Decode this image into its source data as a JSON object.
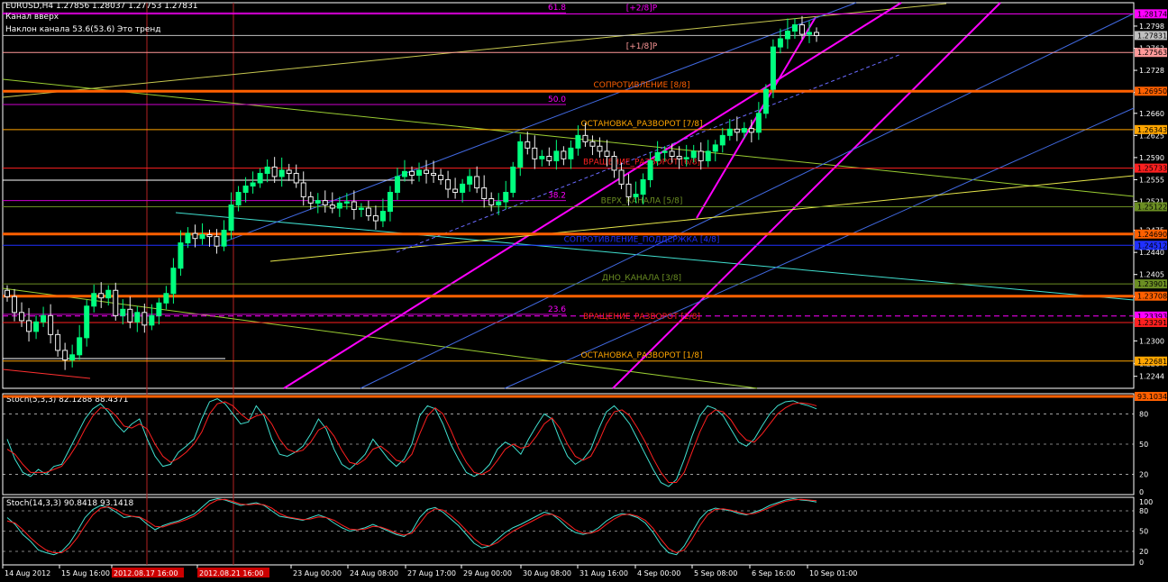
{
  "header": {
    "symbol_line": "EURUSD,H4  1.27856 1.28037 1.27753 1.27831",
    "channel_line": "Канал  вверх",
    "slope_label": "Наклон канала 53.6(53.6)",
    "trend_label": "Это тренд"
  },
  "chart_data": {
    "type": "candlestick",
    "symbol": "EURUSD",
    "timeframe": "H4",
    "ohlc": {
      "open": 1.27856,
      "high": 1.28037,
      "low": 1.27753,
      "close": 1.27831
    },
    "ylim": [
      1.2225,
      1.2835
    ],
    "price_ticks": [
      1.2798,
      1.2763,
      1.2728,
      1.2693,
      1.266,
      1.2625,
      1.259,
      1.2555,
      1.2521,
      1.2475,
      1.244,
      1.2405,
      1.237,
      1.2335,
      1.23,
      1.2264,
      1.2244
    ],
    "closes": [
      1.237,
      1.2345,
      1.2332,
      1.2315,
      1.233,
      1.234,
      1.231,
      1.2285,
      1.227,
      1.2278,
      1.2305,
      1.2355,
      1.2375,
      1.2368,
      1.238,
      1.234,
      1.235,
      1.233,
      1.2345,
      1.2325,
      1.234,
      1.236,
      1.2375,
      1.2415,
      1.2455,
      1.247,
      1.2462,
      1.2468,
      1.2465,
      1.245,
      1.2475,
      1.2515,
      1.2535,
      1.2545,
      1.255,
      1.2565,
      1.2575,
      1.256,
      1.257,
      1.2565,
      1.255,
      1.2528,
      1.2518,
      1.2522,
      1.2515,
      1.251,
      1.2518,
      1.252,
      1.2508,
      1.251,
      1.2498,
      1.249,
      1.2505,
      1.2535,
      1.256,
      1.2568,
      1.2562,
      1.257,
      1.2565,
      1.2562,
      1.2555,
      1.254,
      1.2535,
      1.2548,
      1.256,
      1.2542,
      1.2525,
      1.2515,
      1.252,
      1.2535,
      1.2575,
      1.2615,
      1.2605,
      1.2588,
      1.2592,
      1.2585,
      1.26,
      1.2588,
      1.2605,
      1.2625,
      1.2615,
      1.2608,
      1.26,
      1.2592,
      1.257,
      1.2548,
      1.2528,
      1.2532,
      1.2555,
      1.2585,
      1.2598,
      1.26,
      1.2592,
      1.2588,
      1.259,
      1.26,
      1.2585,
      1.26,
      1.261,
      1.2625,
      1.2635,
      1.263,
      1.2636,
      1.263,
      1.266,
      1.2698,
      1.2765,
      1.2778,
      1.279,
      1.28,
      1.2785,
      1.2788,
      1.2783
    ],
    "horizontal_levels": [
      {
        "price": 1.28174,
        "label": "[+2/8]P",
        "price_label": "1.28174",
        "color": "#ff00ff"
      },
      {
        "price": 1.27831,
        "label": "",
        "price_label": "1.27831",
        "color": "#c0c0c0"
      },
      {
        "price": 1.27563,
        "label": "[+1/8]P",
        "price_label": "1.27563",
        "color": "#ff9999"
      },
      {
        "price": 1.2695,
        "label": "СОПРОТИВЛЕНИЕ [8/8]",
        "price_label": "1.26950",
        "color": "#ff6000"
      },
      {
        "price": 1.26343,
        "label": "ОСТАНОВКА_РАЗВОРОТ [7/8]",
        "price_label": "1.26343",
        "color": "#ffa500"
      },
      {
        "price": 1.25733,
        "label": "ВРАЩЕНИЕ_РАЗВОРОТ [6/8]",
        "price_label": "1.25733",
        "color": "#ff2020"
      },
      {
        "price": 1.25122,
        "label": "ВЕРХ_КАНАЛА [5/8]",
        "price_label": "1.25122",
        "color": "#6b8e23"
      },
      {
        "price": 1.2469,
        "label": "",
        "price_label": "1.24690",
        "color": "#ff6000"
      },
      {
        "price": 1.24512,
        "label": "СОПРОТИВЛЕНИЕ_ПОДДЕРЖКА [4/8]",
        "price_label": "1.24512",
        "color": "#2030ff"
      },
      {
        "price": 1.23901,
        "label": "ДНО_КАНАЛА [3/8]",
        "price_label": "1.23901",
        "color": "#6b8e23"
      },
      {
        "price": 1.23708,
        "label": "",
        "price_label": "1.23708",
        "color": "#ff6000"
      },
      {
        "price": 1.23393,
        "label": "",
        "price_label": "1.23393",
        "color": "#ff00ff"
      },
      {
        "price": 1.23291,
        "label": "ВРАЩЕНИЕ_РАЗВОРОТ [2/8]",
        "price_label": "1.23291",
        "color": "#ff2020"
      },
      {
        "price": 1.22681,
        "label": "ОСТАНОВКА_РАЗВОРОТ [1/8]",
        "price_label": "1.22681",
        "color": "#ffa500"
      }
    ],
    "fib_levels": [
      {
        "label": "61.8",
        "price": 1.2819
      },
      {
        "label": "50.0",
        "price": 1.2674
      },
      {
        "label": "38.2",
        "price": 1.2522
      },
      {
        "label": "23.6",
        "price": 1.2342
      }
    ],
    "x_labels": [
      "14 Aug 2012",
      "15 Aug 16:00",
      "2012.08.17 16:00",
      "2012.08.21 16:00",
      "23 Aug 00:00",
      "24 Aug 08:00",
      "27 Aug 17:00",
      "29 Aug 00:00",
      "30 Aug 08:00",
      "31 Aug 16:00",
      "4 Sep 00:00",
      "5 Sep 08:00",
      "6 Sep 16:00",
      "10 Sep 01:00"
    ],
    "x_label_highlight": [
      "2012.08.17 16:00",
      "2012.08.21 16:00"
    ],
    "stoch1": {
      "label": "Stoch(5,3,3) 82.1288 88.4371",
      "main_value": "82.1288",
      "signal_value": "88.4371",
      "current_marker": "93.1034",
      "ylim": [
        0,
        100
      ],
      "levels": [
        "80",
        "50",
        "20",
        "0"
      ],
      "main": [
        55,
        35,
        22,
        18,
        25,
        20,
        28,
        30,
        45,
        60,
        75,
        85,
        90,
        82,
        70,
        62,
        70,
        75,
        55,
        38,
        28,
        30,
        42,
        48,
        55,
        75,
        92,
        95,
        90,
        80,
        70,
        72,
        88,
        78,
        55,
        40,
        38,
        42,
        48,
        60,
        75,
        65,
        45,
        30,
        25,
        32,
        40,
        55,
        45,
        35,
        28,
        35,
        50,
        78,
        88,
        85,
        70,
        50,
        35,
        22,
        18,
        22,
        30,
        45,
        52,
        48,
        40,
        55,
        68,
        80,
        75,
        55,
        38,
        30,
        35,
        45,
        65,
        82,
        88,
        80,
        70,
        55,
        40,
        25,
        12,
        8,
        15,
        35,
        58,
        78,
        88,
        85,
        78,
        65,
        52,
        48,
        55,
        68,
        80,
        88,
        92,
        93,
        90,
        88,
        85
      ],
      "signal": [
        45,
        40,
        30,
        22,
        22,
        22,
        25,
        28,
        38,
        50,
        65,
        78,
        86,
        85,
        78,
        68,
        66,
        70,
        65,
        50,
        38,
        32,
        36,
        42,
        50,
        62,
        80,
        90,
        92,
        88,
        80,
        74,
        78,
        80,
        70,
        55,
        45,
        42,
        44,
        52,
        64,
        68,
        58,
        44,
        32,
        30,
        35,
        45,
        48,
        42,
        34,
        32,
        40,
        60,
        78,
        86,
        80,
        64,
        46,
        32,
        22,
        20,
        24,
        34,
        45,
        50,
        46,
        48,
        58,
        70,
        76,
        66,
        50,
        38,
        34,
        38,
        52,
        70,
        82,
        84,
        78,
        66,
        52,
        36,
        22,
        12,
        12,
        22,
        42,
        62,
        78,
        84,
        82,
        74,
        62,
        54,
        52,
        60,
        70,
        80,
        86,
        90,
        91,
        90,
        88
      ]
    },
    "stoch2": {
      "label": "Stoch(14,3,3) 90.8418 93.1418",
      "main_value": "90.8418",
      "signal_value": "93.1418",
      "ylim": [
        0,
        100
      ],
      "levels": [
        "100",
        "80",
        "50",
        "20",
        "0"
      ],
      "main": [
        70,
        60,
        45,
        35,
        22,
        18,
        15,
        20,
        32,
        50,
        70,
        82,
        88,
        85,
        78,
        70,
        72,
        70,
        60,
        52,
        58,
        62,
        65,
        70,
        75,
        85,
        95,
        98,
        96,
        92,
        88,
        90,
        92,
        88,
        80,
        72,
        70,
        68,
        66,
        70,
        74,
        70,
        62,
        55,
        50,
        52,
        55,
        60,
        55,
        50,
        45,
        42,
        50,
        70,
        82,
        85,
        78,
        68,
        58,
        45,
        32,
        25,
        28,
        38,
        48,
        55,
        60,
        66,
        72,
        78,
        75,
        66,
        55,
        48,
        45,
        48,
        55,
        65,
        72,
        76,
        74,
        70,
        62,
        48,
        30,
        18,
        15,
        28,
        48,
        68,
        80,
        84,
        82,
        80,
        76,
        74,
        78,
        82,
        88,
        92,
        96,
        98,
        96,
        95,
        93
      ],
      "signal": [
        65,
        62,
        52,
        40,
        30,
        22,
        18,
        18,
        26,
        40,
        58,
        74,
        84,
        86,
        82,
        75,
        72,
        71,
        65,
        57,
        56,
        60,
        63,
        67,
        72,
        80,
        90,
        96,
        97,
        94,
        90,
        89,
        90,
        89,
        84,
        76,
        71,
        69,
        67,
        68,
        71,
        70,
        66,
        59,
        53,
        52,
        53,
        57,
        56,
        52,
        47,
        44,
        47,
        61,
        76,
        83,
        81,
        73,
        63,
        51,
        39,
        30,
        28,
        33,
        42,
        50,
        56,
        62,
        68,
        74,
        75,
        70,
        61,
        52,
        47,
        47,
        51,
        60,
        68,
        74,
        75,
        72,
        66,
        54,
        38,
        24,
        18,
        22,
        38,
        58,
        74,
        82,
        83,
        81,
        78,
        75,
        76,
        80,
        85,
        90,
        94,
        96,
        97,
        96,
        95
      ]
    }
  }
}
